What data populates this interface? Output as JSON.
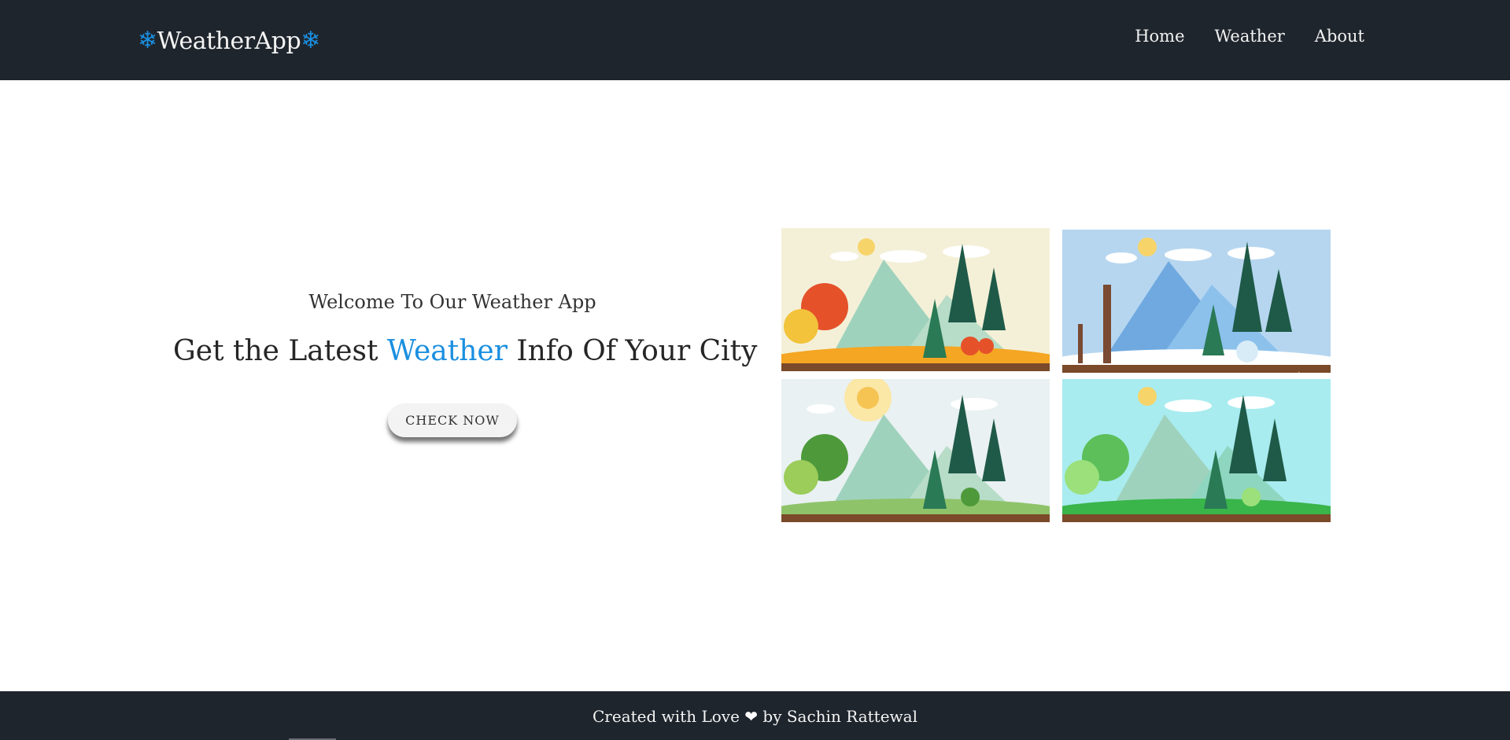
{
  "navbar": {
    "brand": "WeatherApp",
    "brand_icon": "snowflake-icon",
    "links": [
      {
        "label": "Home"
      },
      {
        "label": "Weather"
      },
      {
        "label": "About"
      }
    ]
  },
  "hero": {
    "welcome": "Welcome To Our Weather App",
    "headline_prefix": "Get the Latest ",
    "headline_accent": "Weather",
    "headline_suffix": " Info Of Your City",
    "cta_label": "CHECK NOW"
  },
  "gallery": {
    "prev_arrow": "‹",
    "next_arrow": "›"
  },
  "footer": {
    "text_before": "Created with Love ",
    "heart": "❤",
    "text_after": " by Sachin Rattewal"
  },
  "colors": {
    "nav_bg": "#1f252d",
    "accent": "#1a8fe0"
  }
}
